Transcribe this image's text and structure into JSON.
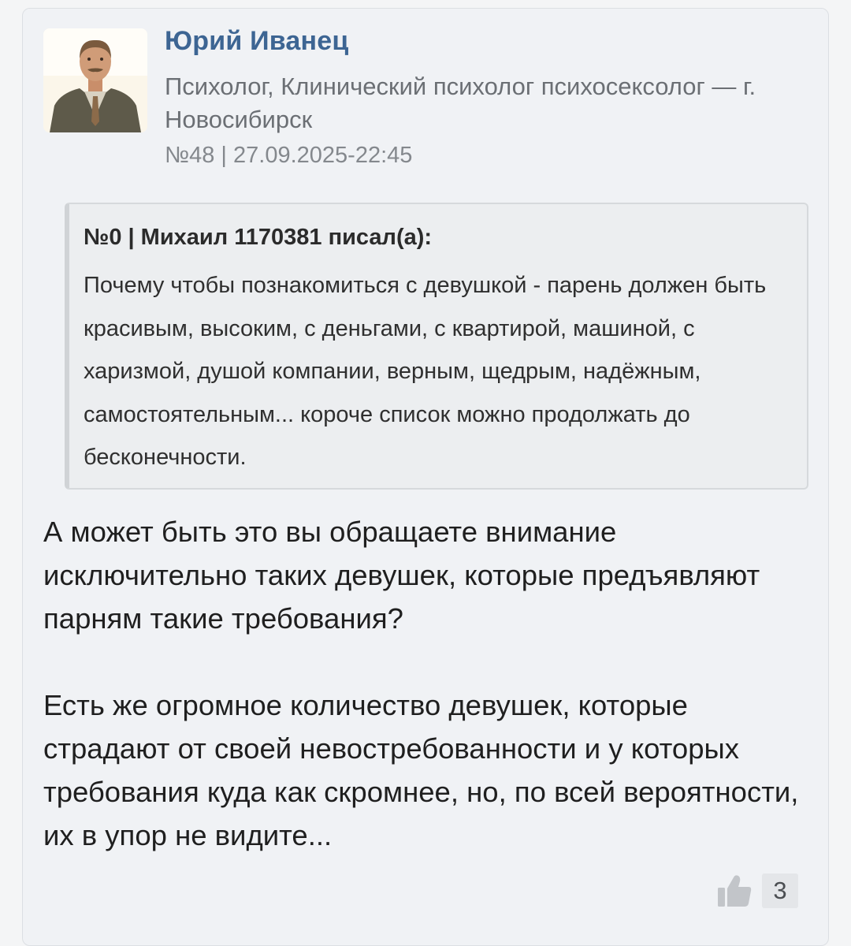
{
  "author": {
    "name": "Юрий Иванец",
    "role": "Психолог, Клинический психолог психосексолог — г. Новосибирск",
    "meta": "№48 | 27.09.2025-22:45",
    "avatar_icon": "person-photo"
  },
  "quote": {
    "header": "№0 | Михаил 1170381 писал(а):",
    "text": "Почему чтобы познакомиться с девушкой - парень должен быть красивым, высоким, с деньгами, с квартирой, машиной, с харизмой, душой компании, верным, щедрым, надёжным, самостоятельным... короче список можно продолжать до бесконечности."
  },
  "answer": {
    "paragraph_1": "А может быть это вы обращаете внимание исключительно таких девушек, которые предъявляют парням такие требования?",
    "paragraph_2": "Есть же огромное количество девушек, которые страдают от своей невостребованности и у которых требования куда как скромнее, но, по всей вероятности, их в упор не видите..."
  },
  "likes": {
    "icon": "thumbs-up-icon",
    "count": "3"
  },
  "colors": {
    "author_name": "#3d6593",
    "card_background": "#f0f2f5",
    "quote_background": "#eceef0"
  }
}
